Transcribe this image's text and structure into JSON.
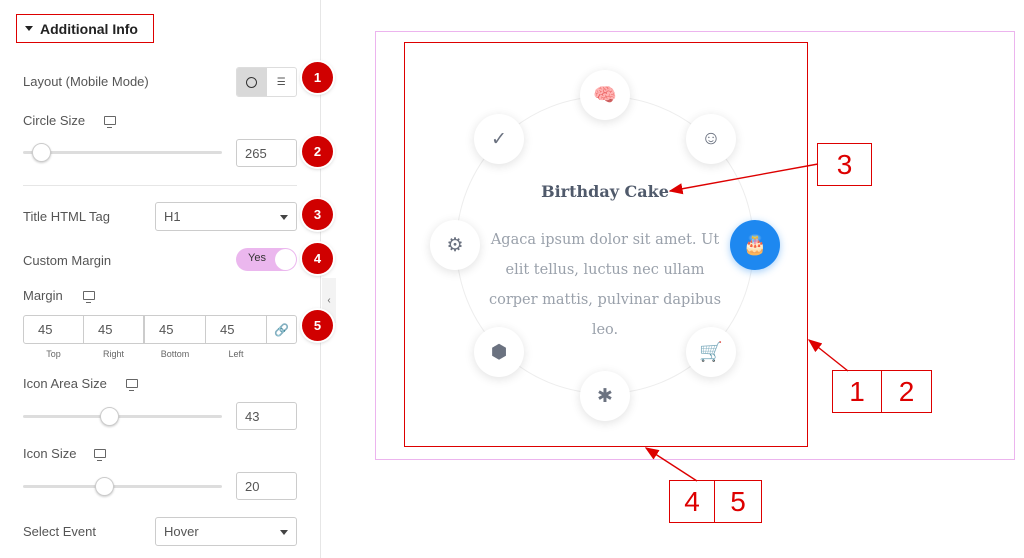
{
  "panel": {
    "section_title": "Additional Info",
    "layout_label": "Layout (Mobile Mode)",
    "circle_size_label": "Circle Size",
    "circle_size_value": "265",
    "title_tag_label": "Title HTML Tag",
    "title_tag_value": "H1",
    "custom_margin_label": "Custom Margin",
    "custom_margin_value": "Yes",
    "margin_label": "Margin",
    "margin_values": [
      "45",
      "45",
      "45",
      "45"
    ],
    "margin_sides": [
      "Top",
      "Right",
      "Bottom",
      "Left"
    ],
    "icon_area_label": "Icon Area Size",
    "icon_area_value": "43",
    "icon_size_label": "Icon Size",
    "icon_size_value": "20",
    "select_event_label": "Select Event",
    "select_event_value": "Hover",
    "collapse_glyph": "‹",
    "link_glyph": "🔗"
  },
  "sliders": {
    "circle_size_fraction": 0.05,
    "icon_area_fraction": 0.43,
    "icon_size_fraction": 0.4
  },
  "badges": [
    "1",
    "2",
    "3",
    "4",
    "5"
  ],
  "preview": {
    "title": "Birthday Cake",
    "description": "Agaca ipsum dolor sit amet. Ut elit tellus, luctus nec ullam corper mattis, pulvinar dapibus leo.",
    "icons": {
      "brain": "🧠",
      "smile": "☺",
      "cake": "🎂",
      "stroller": "🛒",
      "asterisk": "✱",
      "cube": "⬢",
      "gear": "⚙",
      "check": "✓"
    }
  },
  "callouts": [
    "3",
    "1",
    "2",
    "4",
    "5"
  ],
  "colors": {
    "accent_red": "#d00000",
    "active_blue": "#1e88f0",
    "toggle_pink": "#ebb7ee",
    "preview_border": "#ecb4ee"
  }
}
